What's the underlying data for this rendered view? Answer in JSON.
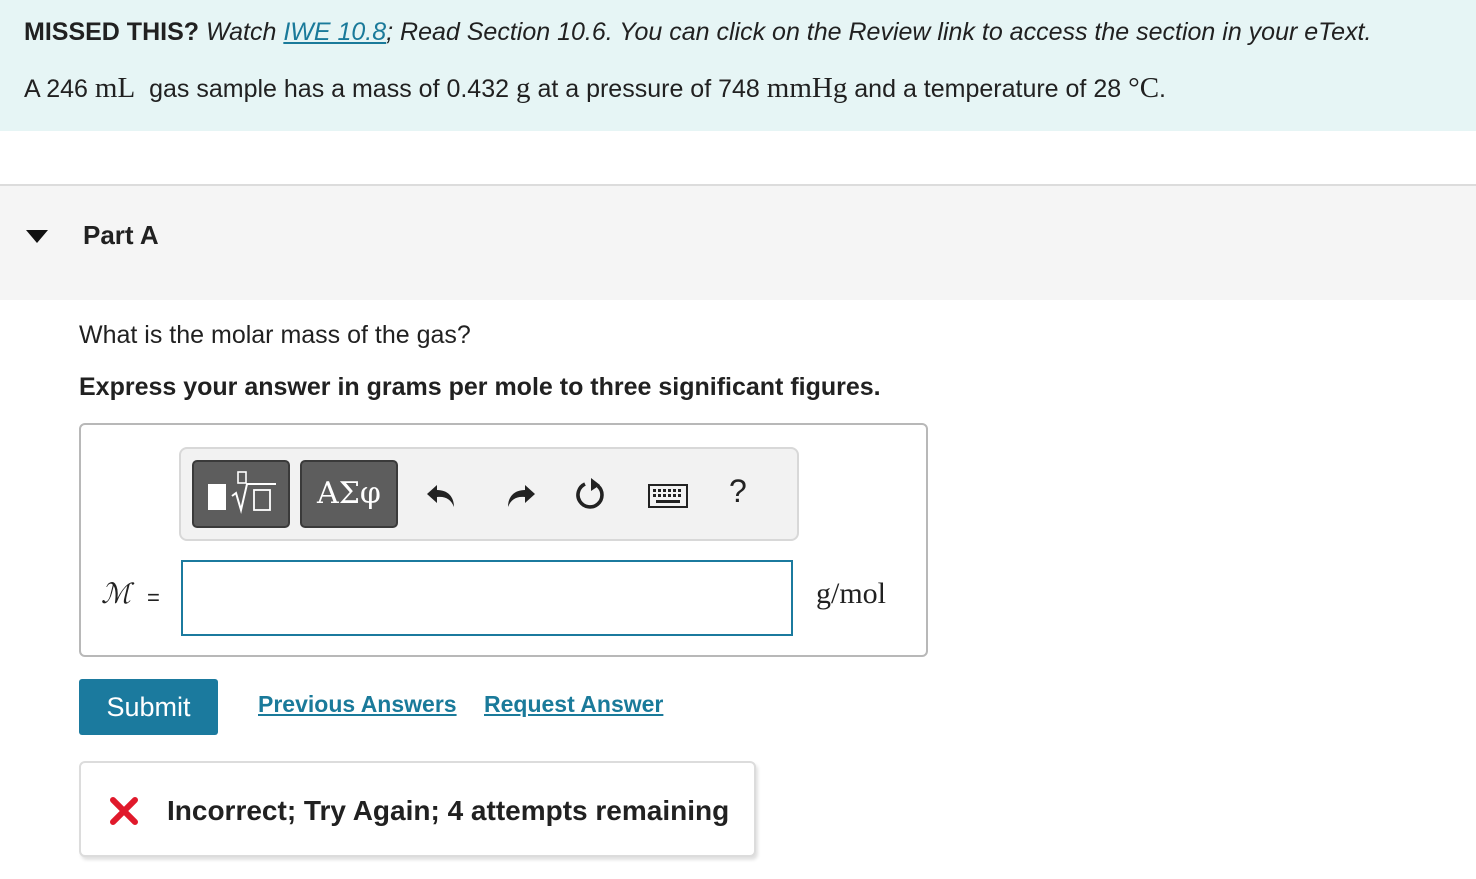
{
  "hint": {
    "missed_label": "MISSED THIS?",
    "watch_prefix": "Watch",
    "iwe_link": "IWE 10.8",
    "rest": "; Read Section 10.6. You can click on the Review link to access the section in your eText.",
    "problem_pre": "A 246",
    "volume_unit": "mL",
    "problem_mid1": "gas sample has a mass of 0.432",
    "mass_unit": "g",
    "problem_mid2": "at a pressure of 748",
    "pressure_unit": "mmHg",
    "problem_mid3": "and a temperature of 28",
    "temp_unit": "°C",
    "problem_end": "."
  },
  "part": {
    "title": "Part A"
  },
  "question": "What is the molar mass of the gas?",
  "instruction": "Express your answer in grams per mole to three significant figures.",
  "toolbar": {
    "symbols_label": "ΑΣφ",
    "help_label": "?",
    "icons": [
      "templates-icon",
      "undo-icon",
      "redo-icon",
      "reset-icon",
      "keyboard-icon",
      "help-icon"
    ]
  },
  "answer": {
    "variable": "ℳ",
    "equals": "=",
    "value": "",
    "unit": "g/mol"
  },
  "actions": {
    "submit": "Submit",
    "previous_answers": "Previous Answers",
    "request_answer": "Request Answer"
  },
  "feedback": {
    "text": "Incorrect; Try Again; 4 attempts remaining",
    "color": "#e0192b"
  },
  "colors": {
    "accent": "#1b7a9e",
    "hint_bg": "#e6f5f5"
  }
}
